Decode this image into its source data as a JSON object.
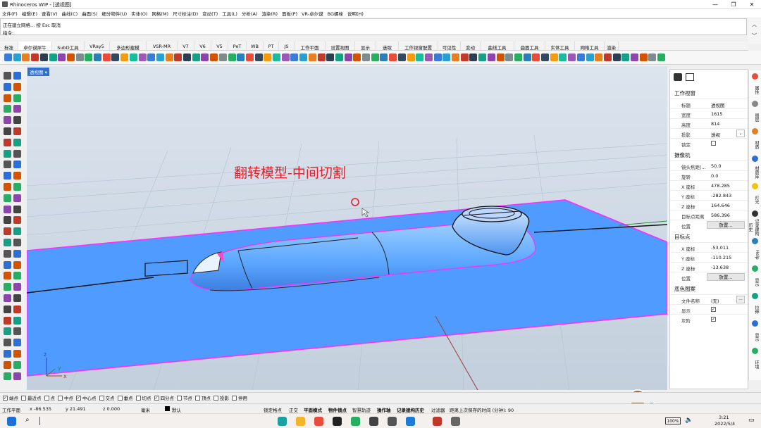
{
  "window": {
    "title": "Rhinoceros WIP - [透视图]"
  },
  "menu": [
    "文件(F)",
    "编辑(E)",
    "查看(V)",
    "曲线(C)",
    "曲面(S)",
    "细分物件(U)",
    "实体(O)",
    "网格(M)",
    "尺寸标注(D)",
    "变动(T)",
    "工具(L)",
    "分析(A)",
    "渲染(R)",
    "面板(P)",
    "VR-卓尔谟",
    "BG螺栓",
    "说明(H)"
  ],
  "command": {
    "history": "正在建立网格... 按 Esc 取消",
    "prompt_label": "指令:",
    "value": ""
  },
  "tabs": [
    "标准",
    "卓尔谟犀牛",
    "SubD工具",
    "VRay5",
    "多边形建模",
    "VSR-MR",
    "V7",
    "V6",
    "V5",
    "PeT",
    "WB",
    "PT",
    "JS",
    "工作平面",
    "设置视图",
    "显示",
    "选取",
    "工作视窗配置",
    "可见性",
    "变动",
    "曲线工具",
    "曲面工具",
    "实体工具",
    "网格工具",
    "渲染"
  ],
  "active_tab": "卓尔谟犀牛",
  "viewport": {
    "label": "透视图",
    "annotation": "翻转模型-中间切割",
    "axis_x": "x",
    "axis_y": "y",
    "axis_z": "z"
  },
  "panel": {
    "section_viewport": "工作视窗",
    "title_label": "标题",
    "title_value": "透视图",
    "width_label": "宽度",
    "width_value": "1615",
    "height_label": "高度",
    "height_value": "814",
    "projection_label": "投影",
    "projection_value": "透视",
    "locked_label": "锁定",
    "section_camera": "摄像机",
    "lens_label": "镜头焦距(...",
    "lens_value": "50.0",
    "rotate_label": "旋转",
    "rotate_value": "0.0",
    "cx_label": "X 座标",
    "cx_value": "478.285",
    "cy_label": "Y 座标",
    "cy_value": "-282.843",
    "cz_label": "Z 座标",
    "cz_value": "164.646",
    "dist_label": "目标点距离",
    "dist_value": "586.396",
    "pos_label": "位置",
    "place_button": "放置...",
    "section_target": "目标点",
    "tx_label": "X 座标",
    "tx_value": "-53.011",
    "ty_label": "Y 座标",
    "ty_value": "-110.215",
    "tz_label": "Z 座标",
    "tz_value": "-13.638",
    "tpos_label": "位置",
    "tplace_button": "放置...",
    "section_wallpaper": "底色图案",
    "file_label": "文件名称",
    "file_value": "(无)",
    "file_button": "...",
    "show_label": "显示",
    "gray_label": "灰阶"
  },
  "side_tabs": [
    "属性",
    "图层",
    "材质",
    "材质库",
    "灯光",
    "记录建构历史",
    "Help",
    "显示",
    "拉伸",
    "显示",
    "环境"
  ],
  "osnap": [
    {
      "label": "端点",
      "checked": true
    },
    {
      "label": "最近点",
      "checked": false
    },
    {
      "label": "点",
      "checked": false
    },
    {
      "label": "中点",
      "checked": false
    },
    {
      "label": "中心点",
      "checked": true
    },
    {
      "label": "交点",
      "checked": false
    },
    {
      "label": "垂点",
      "checked": false
    },
    {
      "label": "切点",
      "checked": false
    },
    {
      "label": "四分点",
      "checked": true
    },
    {
      "label": "节点",
      "checked": false
    },
    {
      "label": "顶点",
      "checked": false
    },
    {
      "label": "投影",
      "checked": false
    },
    {
      "label": "停用",
      "checked": false
    }
  ],
  "status": {
    "cplane": "工作平面",
    "x": "x -86.535",
    "y": "y 21.491",
    "z": "z 0.000",
    "unit": "毫米",
    "layer": "默认",
    "lockgrid": "锁定格点",
    "ortho": "正交",
    "planar": "平面模式",
    "osnap": "物件锁点",
    "smarttrack": "智慧轨迹",
    "gumball": "操作轴",
    "history": "记录建构历史",
    "filter": "过滤器",
    "autosave": "距离上次保存的时间 (分钟): 90",
    "lang": "英"
  },
  "taskbar": {
    "battery": "100%",
    "time": "3:21",
    "date": "2022/5/4"
  },
  "colors": {
    "accent": "#2f6fd0",
    "plane": "#4f9bff",
    "edge": "#ff2dff",
    "annotation": "#e0212b"
  }
}
